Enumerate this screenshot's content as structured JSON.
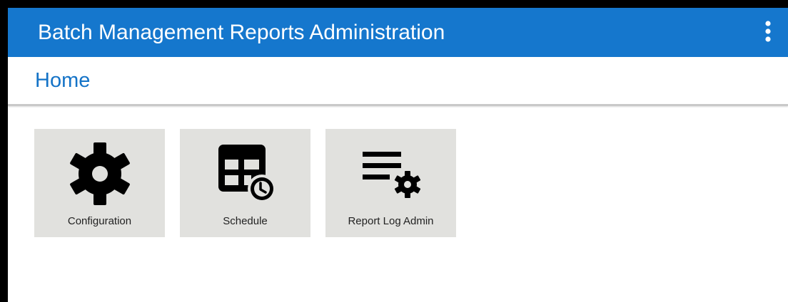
{
  "header": {
    "title": "Batch Management Reports Administration",
    "menu_icon": "more-vertical-icon",
    "background_color": "#1577cd"
  },
  "page": {
    "title": "Home",
    "title_color": "#1473c7"
  },
  "tiles": [
    {
      "label": "Configuration",
      "icon": "gear-icon"
    },
    {
      "label": "Schedule",
      "icon": "schedule-table-clock-icon"
    },
    {
      "label": "Report Log Admin",
      "icon": "list-settings-icon"
    }
  ]
}
